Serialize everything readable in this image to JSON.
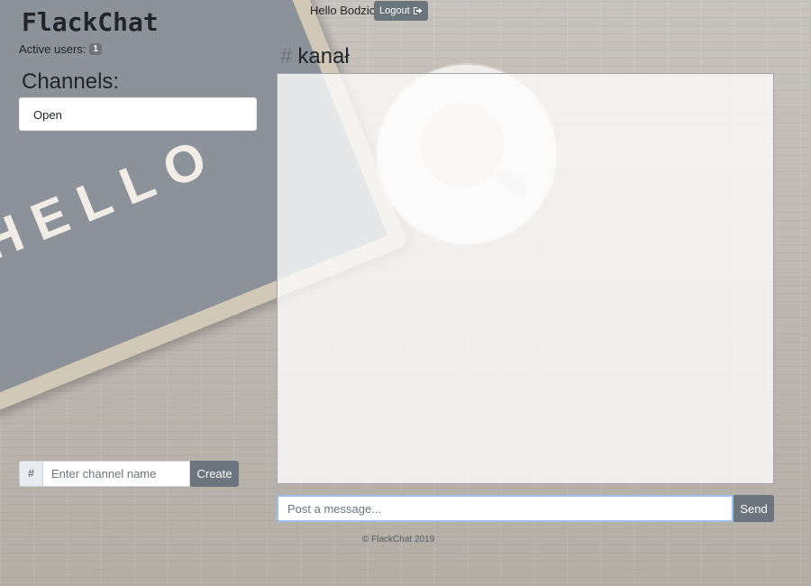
{
  "header": {
    "brand": "FlackChat",
    "active_users_label": "Active users:",
    "active_users_count": "1",
    "greeting": "Hello Bodzio",
    "logout_label": "Logout",
    "logout_icon": "sign-out-icon"
  },
  "background": {
    "board_text": "HELLO"
  },
  "sidebar": {
    "heading": "Channels:",
    "channels": [
      {
        "label": "Open"
      }
    ],
    "create": {
      "prefix": "#",
      "placeholder": "Enter channel name",
      "value": "",
      "button_label": "Create"
    }
  },
  "main": {
    "hash": "#",
    "channel_name": "kanał",
    "messages": [],
    "composer": {
      "placeholder": "Post a message...",
      "value": "",
      "send_label": "Send"
    }
  },
  "footer": {
    "text": "© FlackChat 2019"
  },
  "colors": {
    "button_gray": "#6c757d",
    "focus_border": "#9ec0ee",
    "text_dark": "#212529"
  }
}
